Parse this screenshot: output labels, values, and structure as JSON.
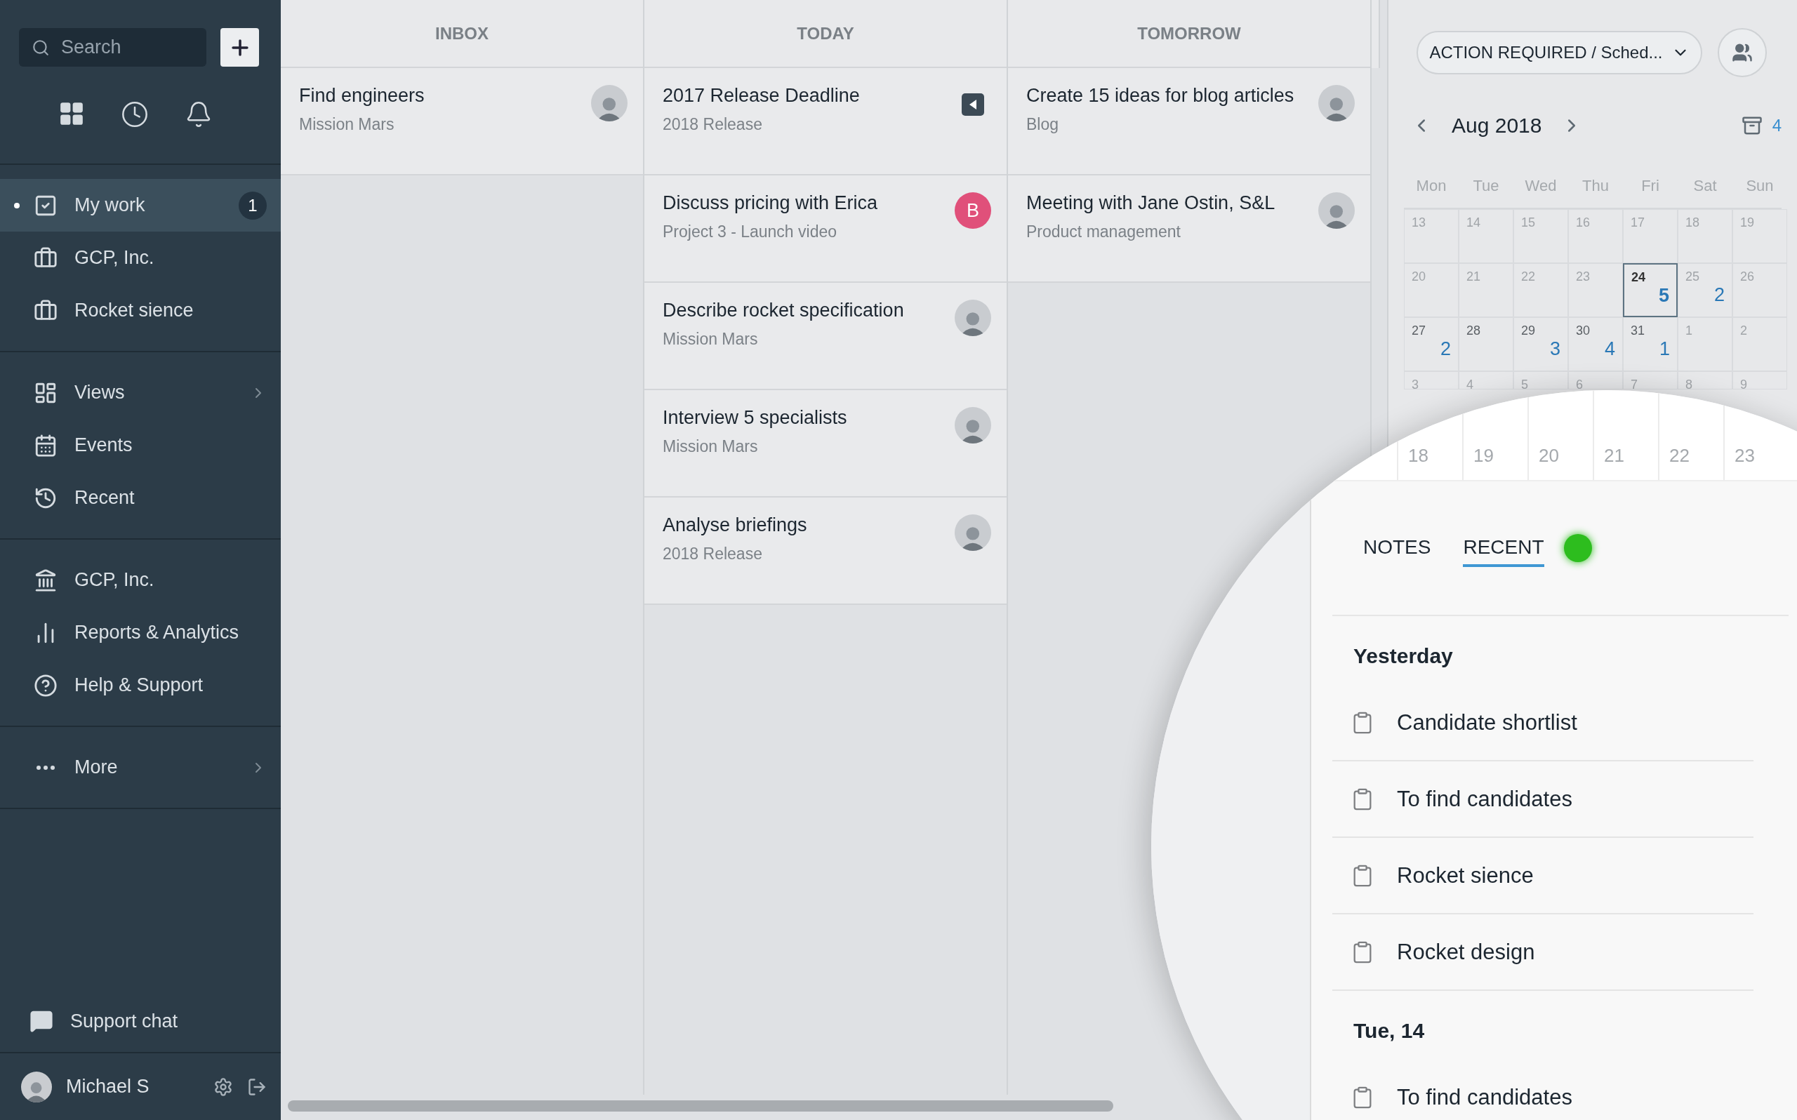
{
  "sidebar": {
    "search": {
      "placeholder": "Search"
    },
    "groups": [
      [
        {
          "label": "My work",
          "selected": true,
          "badge": "1",
          "has_submenu": false
        },
        {
          "label": "GCP, Inc.",
          "selected": false,
          "has_submenu": false
        },
        {
          "label": "Rocket sience",
          "selected": false,
          "has_submenu": false
        }
      ],
      [
        {
          "label": "Views",
          "selected": false,
          "has_submenu": true
        },
        {
          "label": "Events",
          "selected": false,
          "has_submenu": false
        },
        {
          "label": "Recent",
          "selected": false,
          "has_submenu": false
        }
      ],
      [
        {
          "label": "GCP, Inc.",
          "selected": false,
          "has_submenu": false
        },
        {
          "label": "Reports & Analytics",
          "selected": false,
          "has_submenu": false
        },
        {
          "label": "Help & Support",
          "selected": false,
          "has_submenu": false
        }
      ],
      [
        {
          "label": "More",
          "selected": false,
          "has_submenu": true
        }
      ]
    ],
    "support_chat": "Support chat",
    "user": {
      "name": "Michael S"
    }
  },
  "columns": [
    {
      "title": "INBOX",
      "cards": [
        {
          "title": "Find engineers",
          "subtitle": "Mission Mars",
          "assignee": {
            "kind": "photo"
          }
        }
      ]
    },
    {
      "title": "TODAY",
      "cards": [
        {
          "title": "2017 Release Deadline",
          "subtitle": "2018 Release",
          "assignee": {
            "kind": "icon"
          }
        },
        {
          "title": "Discuss pricing with Erica",
          "subtitle": "Project 3 - Launch video",
          "assignee": {
            "kind": "letter",
            "letter": "B",
            "color": "#e0507a"
          }
        },
        {
          "title": "Describe rocket specification",
          "subtitle": "Mission Mars",
          "assignee": {
            "kind": "photo"
          }
        },
        {
          "title": "Interview 5 specialists",
          "subtitle": "Mission Mars",
          "assignee": {
            "kind": "photo"
          }
        },
        {
          "title": "Analyse briefings",
          "subtitle": "2018 Release",
          "assignee": {
            "kind": "photo"
          }
        }
      ]
    },
    {
      "title": "TOMORROW",
      "cards": [
        {
          "title": "Create 15 ideas for blog articles",
          "subtitle": "Blog",
          "assignee": {
            "kind": "photo"
          }
        },
        {
          "title": "Meeting with Jane Ostin, S&L",
          "subtitle": "Product management",
          "assignee": {
            "kind": "photo"
          }
        }
      ]
    }
  ],
  "right_panel": {
    "filter": "ACTION REQUIRED / Sched...",
    "month": "Aug 2018",
    "archive_count": "4",
    "weekdays": [
      "Mon",
      "Tue",
      "Wed",
      "Thu",
      "Fri",
      "Sat",
      "Sun"
    ],
    "weeks": [
      [
        {
          "day": "13",
          "muted": true
        },
        {
          "day": "14",
          "muted": true
        },
        {
          "day": "15",
          "muted": true
        },
        {
          "day": "16",
          "muted": true
        },
        {
          "day": "17",
          "muted": true
        },
        {
          "day": "18",
          "muted": true
        },
        {
          "day": "19",
          "muted": true
        }
      ],
      [
        {
          "day": "20",
          "muted": true
        },
        {
          "day": "21",
          "muted": true
        },
        {
          "day": "22",
          "muted": true
        },
        {
          "day": "23",
          "muted": true
        },
        {
          "day": "24",
          "muted": false,
          "selected": true,
          "count": "5"
        },
        {
          "day": "25",
          "muted": true,
          "count": "2"
        },
        {
          "day": "26",
          "muted": true
        }
      ],
      [
        {
          "day": "27",
          "muted": false,
          "count": "2"
        },
        {
          "day": "28",
          "muted": false
        },
        {
          "day": "29",
          "muted": false,
          "count": "3"
        },
        {
          "day": "30",
          "muted": false,
          "count": "4"
        },
        {
          "day": "31",
          "muted": false,
          "count": "1"
        },
        {
          "day": "1",
          "muted": true
        },
        {
          "day": "2",
          "muted": true
        }
      ],
      [
        {
          "day": "3",
          "muted": true
        },
        {
          "day": "4",
          "muted": true
        },
        {
          "day": "5",
          "muted": true
        },
        {
          "day": "6",
          "muted": true
        },
        {
          "day": "7",
          "muted": true
        },
        {
          "day": "8",
          "muted": true
        },
        {
          "day": "9",
          "muted": true
        }
      ]
    ]
  },
  "magnifier": {
    "days": [
      "18",
      "19",
      "20",
      "21",
      "22",
      "23"
    ],
    "tabs": [
      {
        "label": "NOTES",
        "selected": false
      },
      {
        "label": "RECENT",
        "selected": true
      }
    ],
    "status_dot": {
      "color": "#2dbd1e"
    },
    "sections": [
      {
        "title": "Yesterday",
        "items": [
          "Candidate shortlist",
          "To find candidates",
          "Rocket sience",
          "Rocket design"
        ]
      },
      {
        "title": "Tue, 14",
        "items": [
          "To find candidates"
        ]
      }
    ]
  }
}
